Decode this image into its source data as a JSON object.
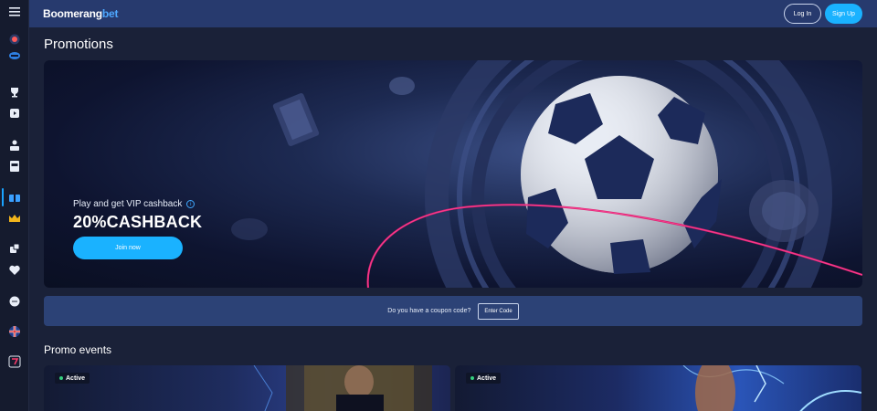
{
  "header": {
    "brand_main": "Boomerang",
    "brand_accent": "bet",
    "login_label": "Log In",
    "signup_label": "Sign Up"
  },
  "sidebar": {
    "icons": [
      "menu-icon",
      "sports-icon",
      "live-icon",
      "trophy-icon",
      "casino-icon",
      "dealer-icon",
      "slot-machine-icon",
      "promotions-icon",
      "vip-crown-icon",
      "dice-icon",
      "favorites-heart-icon",
      "chat-icon",
      "uk-flag-icon",
      "app-icon"
    ]
  },
  "page": {
    "title": "Promotions"
  },
  "hero": {
    "subtitle": "Play and get VIP cashback",
    "info": "i",
    "title": "20%CASHBACK",
    "cta_label": "Join now"
  },
  "coupon": {
    "question": "Do you have a coupon code?",
    "button_label": "Enter Code"
  },
  "promo_events": {
    "title": "Promo events",
    "cards": [
      {
        "status": "Active"
      },
      {
        "status": "Active"
      }
    ]
  },
  "colors": {
    "background": "#1a2138",
    "header": "#273a6e",
    "accent": "#1ab2ff",
    "active_dot": "#35d07f"
  }
}
